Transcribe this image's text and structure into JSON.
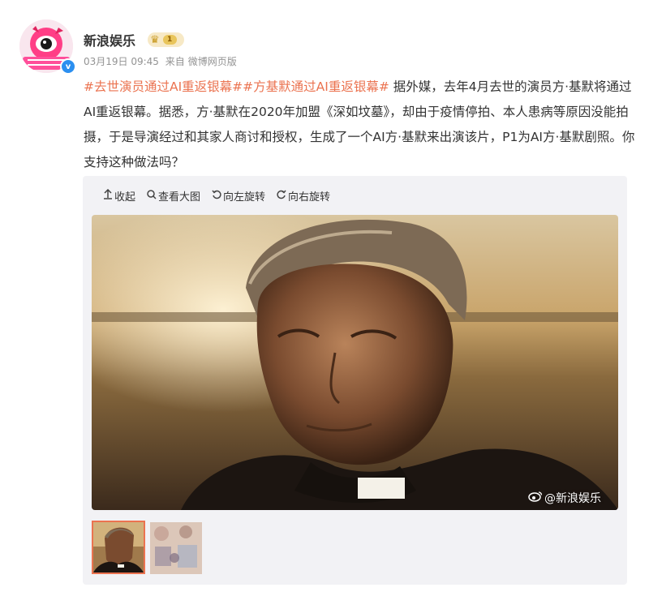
{
  "user": {
    "name": "新浪娱乐",
    "level": "1",
    "verified_mark": "v"
  },
  "meta": {
    "date": "03月19日 09:45",
    "source_prefix": "来自",
    "source": "微博网页版"
  },
  "post": {
    "tag1": "#去世演员通过AI重返银幕#",
    "tag2": "#方基默通过AI重返银幕#",
    "body": " 据外媒，去年4月去世的演员方·基默将通过AI重返银幕。据悉，方·基默在2020年加盟《深如坟墓》，却由于疫情停拍、本人患病等原因没能拍摄，于是导演经过和其家人商讨和授权，生成了一个AI方·基默来出演该片，P1为AI方·基默剧照。你支持这种做法吗？"
  },
  "toolbar": {
    "collapse": "收起",
    "view_large": "查看大图",
    "rotate_left": "向左旋转",
    "rotate_right": "向右旋转"
  },
  "watermark": "@新浪娱乐",
  "icons": {
    "collapse": "arrow-up-icon",
    "view_large": "magnifier-icon",
    "rotate_left": "rotate-left-icon",
    "rotate_right": "rotate-right-icon",
    "watermark": "weibo-logo-icon",
    "level": "crown-icon"
  },
  "colors": {
    "tag": "#eb7350",
    "meta": "#939393",
    "selected_thumb_border": "#eb7350",
    "verified": "#2b8ff0"
  }
}
